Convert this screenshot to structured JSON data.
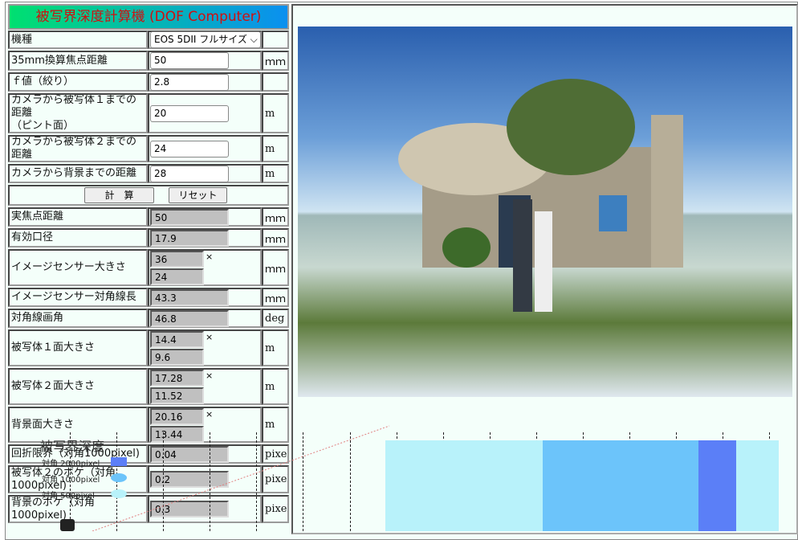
{
  "title": "被写界深度計算機 (DOF Computer)",
  "rows": [
    {
      "label": "機種",
      "select": "EOS 5DII フルサイズ",
      "unit": ""
    },
    {
      "label": "35mm換算焦点距離",
      "value": "50",
      "unit": "ｍｍ"
    },
    {
      "label": "ｆ値（絞り）",
      "value": "2.8",
      "unit": ""
    },
    {
      "label": "カメラから被写体１までの距離\n（ピント面）",
      "value": "20",
      "unit": "m"
    },
    {
      "label": "カメラから被写体２までの距離",
      "value": "24",
      "unit": "m"
    },
    {
      "label": "カメラから背景までの距離",
      "value": "28",
      "unit": "m"
    },
    {
      "buttons": [
        "計　算",
        "リセット"
      ]
    },
    {
      "label": "実焦点距離",
      "value": "50",
      "unit": "ｍｍ",
      "ro": true
    },
    {
      "label": "有効口径",
      "value": "17.9",
      "unit": "ｍｍ",
      "ro": true
    },
    {
      "label": "イメージセンサー大きさ",
      "value": "36",
      "value2": "24",
      "unit": "ｍｍ",
      "ro": true
    },
    {
      "label": "イメージセンサー対角線長",
      "value": "43.3",
      "unit": "ｍｍ",
      "ro": true
    },
    {
      "label": "対角線画角",
      "value": "46.8",
      "unit": "deg",
      "ro": true
    },
    {
      "label": "被写体１面大きさ",
      "value": "14.4",
      "value2": "9.6",
      "unit": "m",
      "ro": true
    },
    {
      "label": "被写体２面大きさ",
      "value": "17.28",
      "value2": "11.52",
      "unit": "m",
      "ro": true
    },
    {
      "label": "背景面大きさ",
      "value": "20.16",
      "value2": "13.44",
      "unit": "m",
      "ro": true
    },
    {
      "label": "回折限界（対角1000pixel)",
      "value": "0.04",
      "unit": "pixel",
      "ro": true
    },
    {
      "label": "被写体２のボケ（対角1000pixel)",
      "value": "0.2",
      "unit": "pixel",
      "ro": true
    },
    {
      "label": "背景のボケ（対角1000pixel)",
      "value": "0.3",
      "unit": "pixel",
      "ro": true
    }
  ],
  "times": "×",
  "chart": {
    "title": "被写界深度",
    "legend": [
      {
        "label": "対角 2000pixel",
        "color": "#5b7ff7"
      },
      {
        "label": "対角 1000pixel",
        "color": "#6cc4fa"
      },
      {
        "label": "対角  500pixel",
        "color": "#b8f2fa"
      }
    ]
  }
}
